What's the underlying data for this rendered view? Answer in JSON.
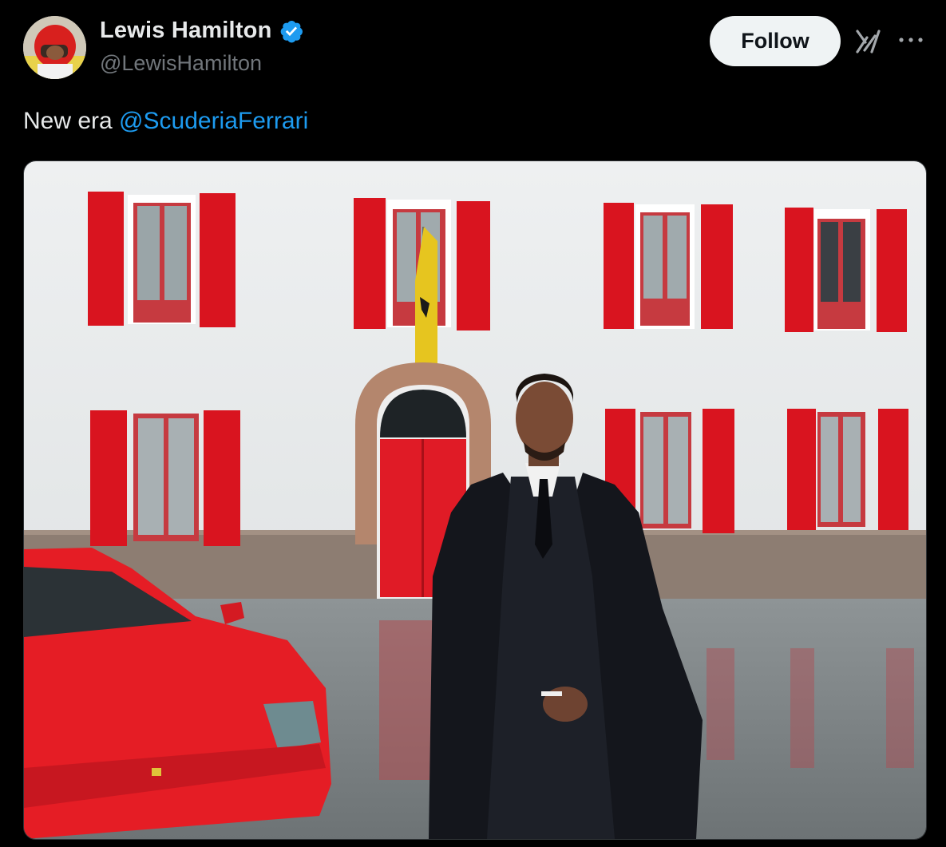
{
  "author": {
    "display_name": "Lewis Hamilton",
    "handle": "@LewisHamilton",
    "verified_icon": "verified-badge-icon",
    "avatar_icon": "avatar"
  },
  "actions": {
    "follow_label": "Follow",
    "grok_icon": "grok-icon",
    "more_icon": "more-options-icon"
  },
  "tweet": {
    "text_prefix": "New era ",
    "mention": "@ScuderiaFerrari"
  },
  "colors": {
    "background": "#000000",
    "text": "#e7e9ea",
    "secondary_text": "#71767b",
    "link": "#1d9bf0",
    "verified": "#1d9bf0",
    "follow_bg": "#eff3f4",
    "ferrari_red": "#e3121e"
  }
}
